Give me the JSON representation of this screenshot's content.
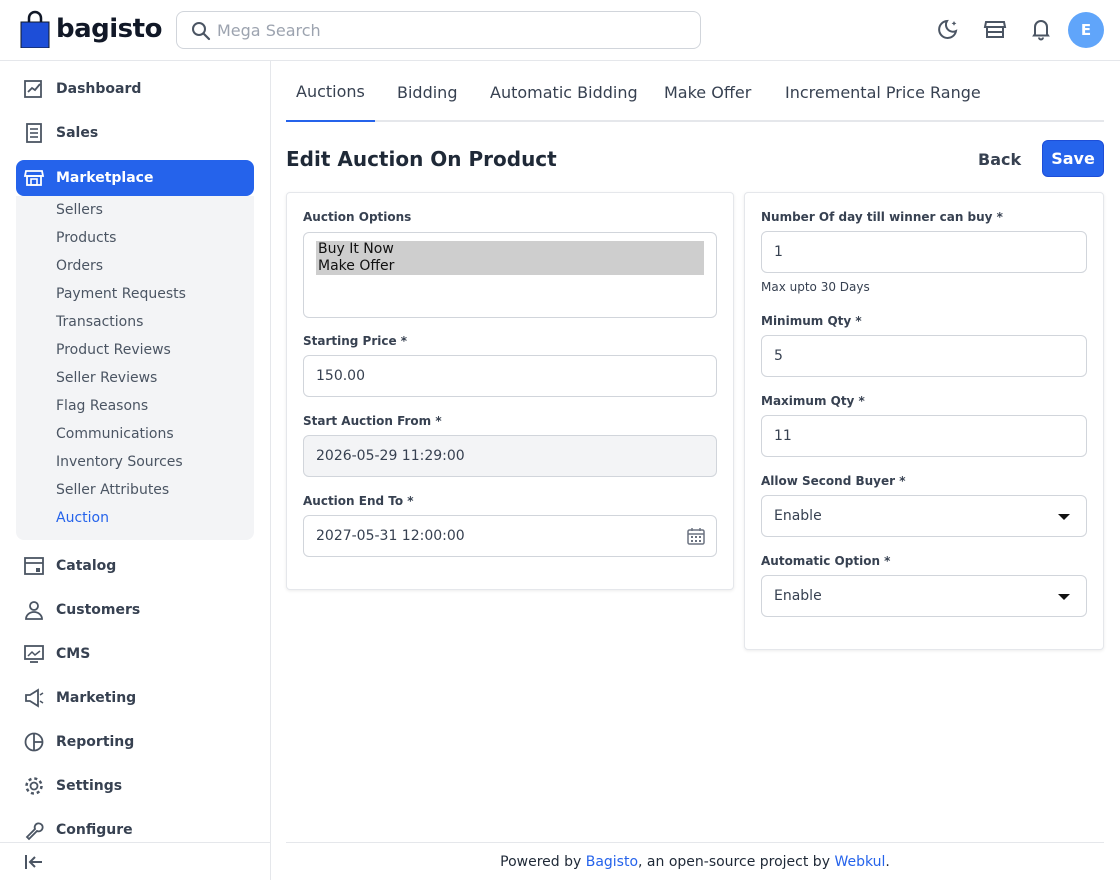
{
  "header": {
    "logo_text": "bagisto",
    "search_placeholder": "Mega Search",
    "avatar_initial": "E"
  },
  "sidebar": {
    "items": [
      {
        "label": "Dashboard",
        "icon": "dashboard-icon"
      },
      {
        "label": "Sales",
        "icon": "sales-icon"
      },
      {
        "label": "Marketplace",
        "icon": "marketplace-icon"
      },
      {
        "label": "Catalog",
        "icon": "catalog-icon"
      },
      {
        "label": "Customers",
        "icon": "customers-icon"
      },
      {
        "label": "CMS",
        "icon": "cms-icon"
      },
      {
        "label": "Marketing",
        "icon": "marketing-icon"
      },
      {
        "label": "Reporting",
        "icon": "reporting-icon"
      },
      {
        "label": "Settings",
        "icon": "settings-icon"
      },
      {
        "label": "Configure",
        "icon": "configure-icon"
      }
    ],
    "submenu": [
      "Sellers",
      "Products",
      "Orders",
      "Payment Requests",
      "Transactions",
      "Product Reviews",
      "Seller Reviews",
      "Flag Reasons",
      "Communications",
      "Inventory Sources",
      "Seller Attributes",
      "Auction"
    ]
  },
  "tabs": [
    "Auctions",
    "Bidding",
    "Automatic Bidding",
    "Make Offer",
    "Incremental Price Range"
  ],
  "page": {
    "title": "Edit Auction On Product",
    "back_label": "Back",
    "save_label": "Save"
  },
  "left_card": {
    "auction_options_label": "Auction Options",
    "auction_options": [
      "Buy It Now",
      "Make Offer"
    ],
    "starting_price_label": "Starting Price *",
    "starting_price_value": "150.00",
    "start_from_label": "Start Auction From *",
    "start_from_value": "2026-05-29 11:29:00",
    "end_to_label": "Auction End To *",
    "end_to_value": "2027-05-31 12:00:00"
  },
  "right_card": {
    "days_label": "Number Of day till winner can buy *",
    "days_value": "1",
    "days_hint": "Max upto 30 Days",
    "min_qty_label": "Minimum Qty *",
    "min_qty_value": "5",
    "max_qty_label": "Maximum Qty *",
    "max_qty_value": "11",
    "second_buyer_label": "Allow Second Buyer *",
    "second_buyer_value": "Enable",
    "auto_option_label": "Automatic Option *",
    "auto_option_value": "Enable"
  },
  "footer": {
    "prefix": "Powered by ",
    "link1": "Bagisto",
    "middle": ", an open-source project by ",
    "link2": "Webkul",
    "suffix": "."
  },
  "colors": {
    "accent": "#2563eb",
    "avatar": "#60a5fa"
  }
}
